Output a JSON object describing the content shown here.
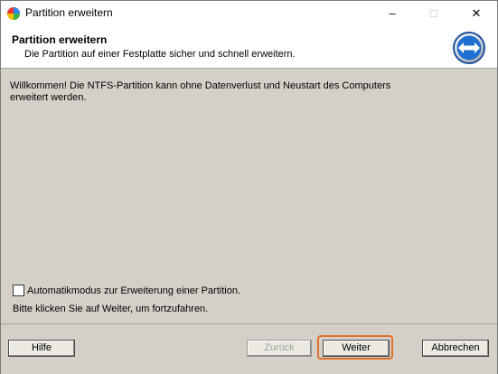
{
  "window": {
    "title": "Partition erweitern"
  },
  "titlebar": {
    "minimize": "–",
    "maximize": "□",
    "close": "✕"
  },
  "header": {
    "title": "Partition erweitern",
    "subtitle": "Die Partition auf einer Festplatte sicher und schnell erweitern.",
    "icon": "resize-arrows-icon"
  },
  "content": {
    "welcome": "Willkommen! Die NTFS-Partition kann ohne Datenverlust und Neustart des Computers erweitert werden.",
    "auto_mode_label": "Automatikmodus zur Erweiterung einer Partition.",
    "auto_mode_checked": false,
    "hint": "Bitte klicken Sie auf Weiter, um fortzufahren."
  },
  "footer": {
    "help_label": "Hilfe",
    "back_label": "Zurück",
    "next_label": "Weiter",
    "cancel_label": "Abbrechen"
  },
  "colors": {
    "accent_focus": "#e0702a",
    "panel_bg": "#d4d0c8",
    "header_icon_blue": "#1f6fd0"
  }
}
